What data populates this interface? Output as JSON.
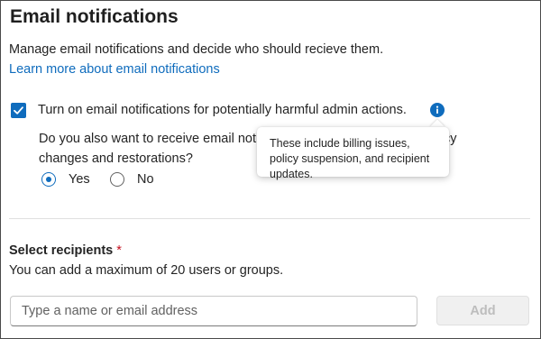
{
  "panel": {
    "title": "Email notifications",
    "description": "Manage email notifications and decide who should recieve them.",
    "learn_more_link": "Learn more about email notifications"
  },
  "harmful_actions": {
    "checkbox_checked": true,
    "checkbox_label": "Turn on email notifications for potentially harmful admin actions.",
    "question": "Do you also want to receive email notifications about changes like policy changes and restorations?",
    "options": [
      {
        "label": "Yes",
        "selected": true
      },
      {
        "label": "No",
        "selected": false
      }
    ]
  },
  "tooltip": {
    "text": "These include billing issues, policy suspension, and recipient updates."
  },
  "recipients": {
    "title": "Select recipients",
    "required_marker": "*",
    "description": "You can add a maximum of 20 users or groups.",
    "input_placeholder": "Type a name or email address",
    "input_value": "",
    "add_button_label": "Add",
    "add_button_disabled": true
  },
  "colors": {
    "accent": "#0f6cbd",
    "required": "#c50f1f",
    "disabled_text": "#bdbdbd"
  },
  "icons": {
    "checkbox": "checkmark-icon",
    "info": "info-icon"
  }
}
